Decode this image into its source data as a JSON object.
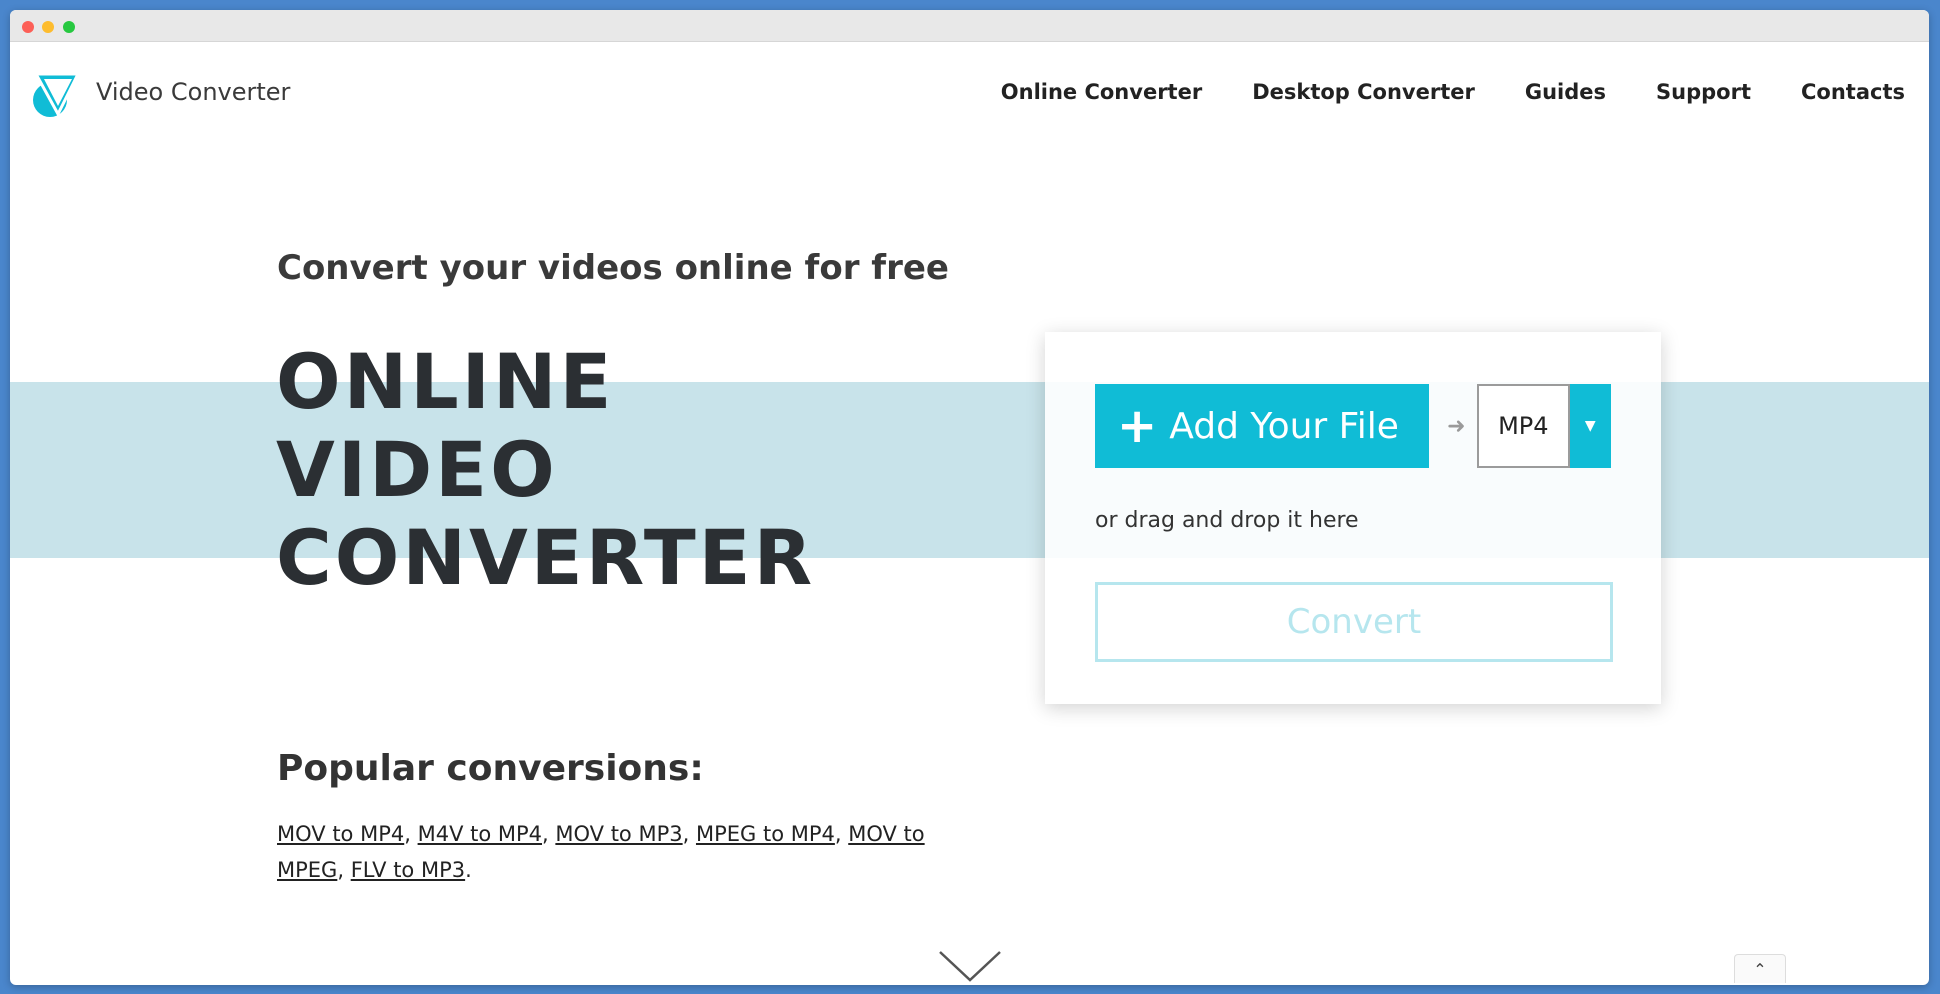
{
  "brand": {
    "name": "Video Converter",
    "logo": "video-converter-logo"
  },
  "nav": [
    {
      "label": "Online Converter"
    },
    {
      "label": "Desktop Converter"
    },
    {
      "label": "Guides"
    },
    {
      "label": "Support"
    },
    {
      "label": "Contacts"
    }
  ],
  "hero": {
    "subtitle": "Convert your videos online for free",
    "title_lines": [
      "ONLINE",
      "VIDEO",
      "CONVERTER"
    ]
  },
  "uploader": {
    "add_file_label": "Add Your File",
    "format_value": "MP4",
    "drag_text": "or drag and drop it here",
    "convert_label": "Convert"
  },
  "popular": {
    "heading": "Popular conversions:",
    "items": [
      "MOV to MP4",
      "M4V to MP4",
      "MOV to MP3",
      "MPEG to MP4",
      "MOV to MPEG",
      "FLV to MP3"
    ]
  },
  "colors": {
    "accent": "#10bcd6",
    "band": "#c8e3ea",
    "text_dark": "#2b2f33"
  }
}
